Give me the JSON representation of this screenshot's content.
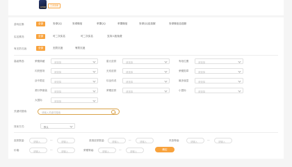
{
  "colors": {
    "accent": "#f8a23c",
    "search_border": "#d9a24a"
  },
  "header": {
    "logo_text": "王者荣耀",
    "badge": "王者荣耀"
  },
  "filters": {
    "area": {
      "label": "游戏区服:",
      "options": [
        "全部",
        "安卓QQ",
        "安卓微信",
        "苹果QQ",
        "苹果微信",
        "安卓QQ自选服",
        "安卓微信自选服"
      ]
    },
    "realname": {
      "label": "实名情况:",
      "options": [
        "全部",
        "可二次实名",
        "可二次实名",
        "支持人脸免费"
      ]
    },
    "anti": {
      "label": "有无防沉迷:",
      "options": [
        "全部",
        "无防沉迷",
        "有防沉迷"
      ]
    }
  },
  "advanced": {
    "label": "高级筛选:",
    "placeholder": "请选择",
    "col1": [
      "荣耀典藏",
      "闪亮登场",
      "战令限定",
      "源分享套装",
      "大国标"
    ],
    "col2": [
      "星元皮肤",
      "无双皮肤",
      "珍品传说",
      "荣耀皮肤"
    ],
    "col3": [
      "有段位置",
      "荣耀勋章",
      "最多值显",
      "小国标"
    ]
  },
  "keyword": {
    "label": "关键词搜索:",
    "placeholder": "请输入关键词搜索"
  },
  "sort": {
    "label": "排序方式:",
    "value": "默认"
  },
  "ranges": {
    "placeholder": "请输入",
    "row1": [
      "皮肤数量:",
      "英雄皮肤数量:",
      "贵族等级:"
    ],
    "row2": [
      "价格:",
      "荣耀等级:"
    ],
    "confirm": "确定"
  }
}
